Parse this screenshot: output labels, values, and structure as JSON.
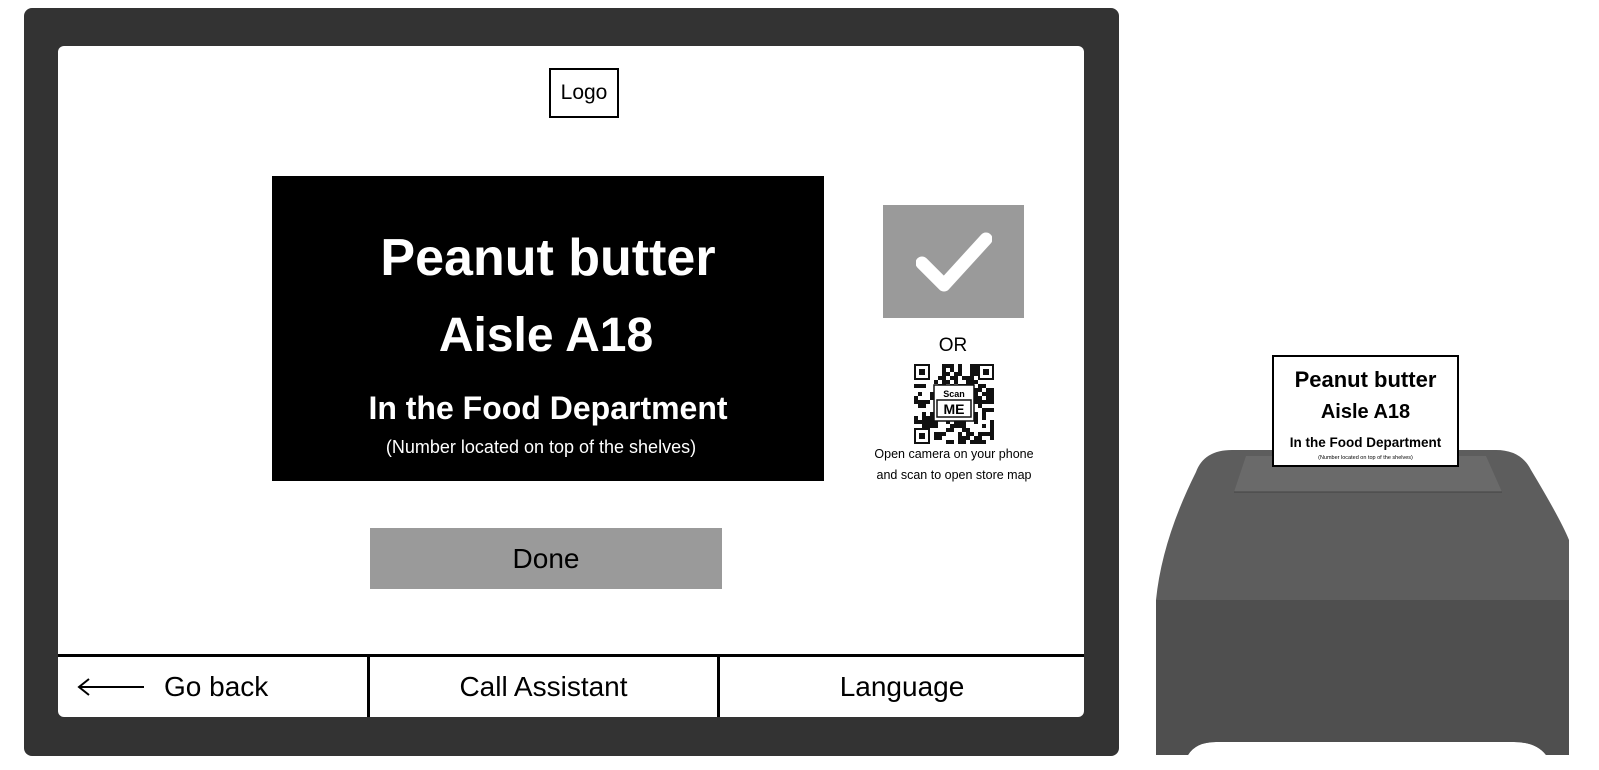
{
  "logo": {
    "label": "Logo"
  },
  "result": {
    "product": "Peanut butter",
    "aisle": "Aisle A18",
    "department": "In the Food Department",
    "note": "(Number located on top of the shelves)"
  },
  "confirm": {
    "icon": "checkmark-icon",
    "color": "#9a9a9a"
  },
  "or_label": "OR",
  "qr": {
    "badge_top": "Scan",
    "badge_bottom": "ME",
    "icon": "qr-code-icon"
  },
  "scan_hint": {
    "line1": "Open camera on your phone",
    "line2": "and scan to open store map"
  },
  "done_label": "Done",
  "bottom_bar": {
    "back_icon": "arrow-left-icon",
    "back": "Go back",
    "call": "Call Assistant",
    "language": "Language"
  },
  "receipt": {
    "product": "Peanut butter",
    "aisle": "Aisle A18",
    "department": "In the Food Department",
    "note": "(Number located on top of the shelves)"
  },
  "colors": {
    "device": "#333333",
    "panel": "#000000",
    "button": "#9a9a9a",
    "printer": "#5d5d5d"
  }
}
